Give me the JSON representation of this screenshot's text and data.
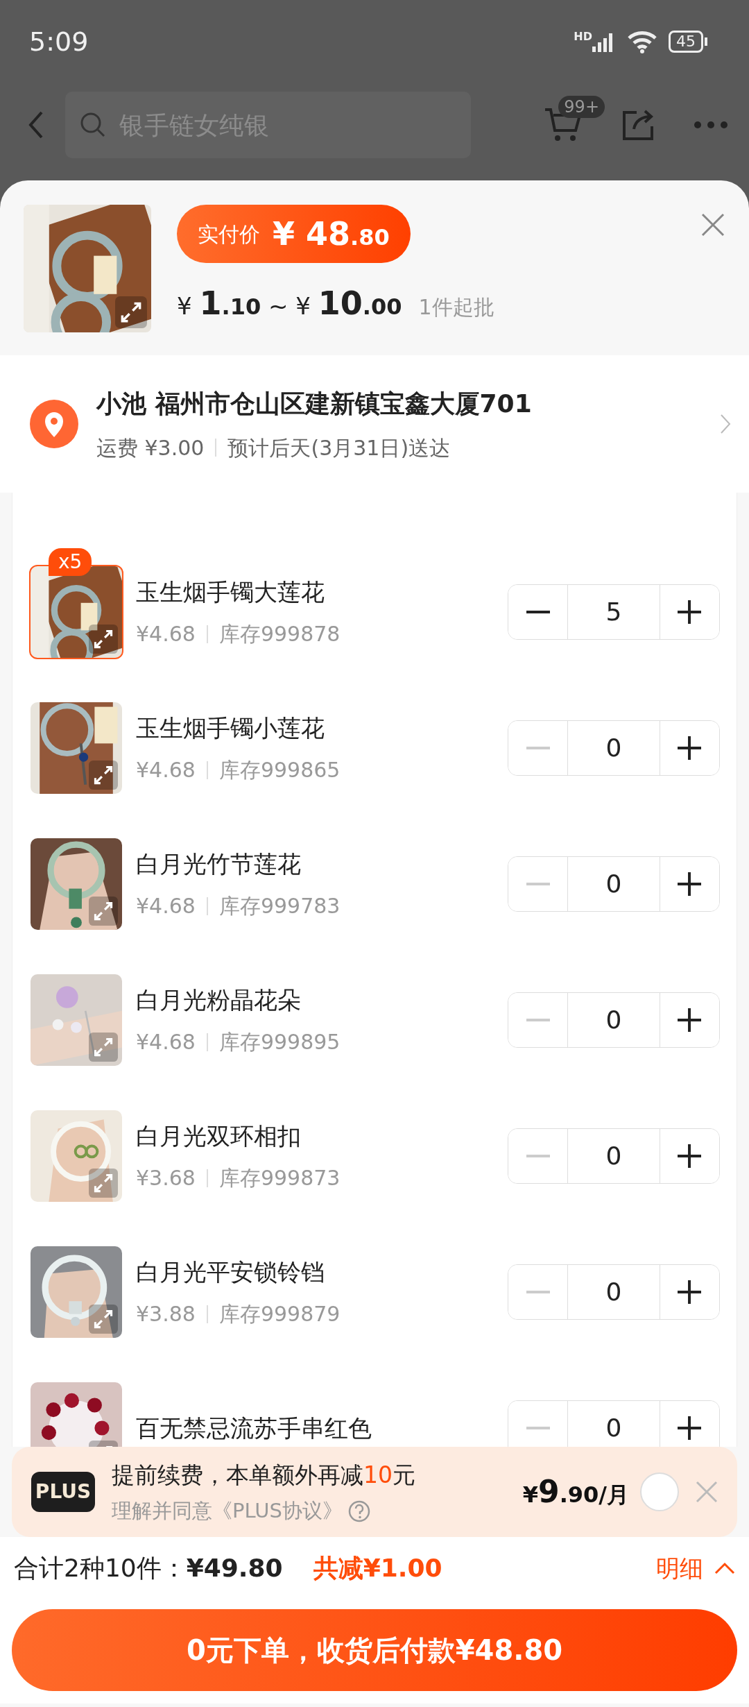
{
  "status_bar": {
    "time": "5:09",
    "network": "HD",
    "battery": "45"
  },
  "top_bar": {
    "search": {
      "placeholder": "银手链女纯银"
    },
    "cart_badge": "99+"
  },
  "sheet": {
    "pay_label": "实付价",
    "pay_price": {
      "currency": "¥",
      "whole": "48",
      "fraction": ".80"
    },
    "range": [
      {
        "currency": "¥",
        "whole": "1",
        "fraction": ".10"
      },
      {
        "currency": "¥",
        "whole": "10",
        "fraction": ".00"
      }
    ],
    "range_sep": "~",
    "min_order": "1件起批"
  },
  "address": {
    "line": "小池 福州市仓山区建新镇宝鑫大厦701",
    "shipping_label": "运费",
    "shipping": "¥3.00",
    "delivery": "预计后天(3月31日)送达"
  },
  "items": [
    {
      "name": "玉生烟手镯大莲花",
      "price": "¥4.68",
      "stock": "库存999878",
      "quantity": "5",
      "badge": "x5",
      "selected": true,
      "decrease_disabled": false
    },
    {
      "name": "玉生烟手镯小莲花",
      "price": "¥4.68",
      "stock": "库存999865",
      "quantity": "0",
      "selected": false,
      "decrease_disabled": true
    },
    {
      "name": "白月光竹节莲花",
      "price": "¥4.68",
      "stock": "库存999783",
      "quantity": "0",
      "selected": false,
      "decrease_disabled": true
    },
    {
      "name": "白月光粉晶花朵",
      "price": "¥4.68",
      "stock": "库存999895",
      "quantity": "0",
      "selected": false,
      "decrease_disabled": true
    },
    {
      "name": "白月光双环相扣",
      "price": "¥3.68",
      "stock": "库存999873",
      "quantity": "0",
      "selected": false,
      "decrease_disabled": true
    },
    {
      "name": "白月光平安锁铃铛",
      "price": "¥3.88",
      "stock": "库存999879",
      "quantity": "0",
      "selected": false,
      "decrease_disabled": true
    },
    {
      "name": "百无禁忌流苏手串红色",
      "quantity": "0",
      "selected": false,
      "decrease_disabled": true
    }
  ],
  "plus_offer": {
    "logo": "PLUS",
    "title_before": "提前续费，本单额外再减",
    "title_highlight": "10",
    "title_after": "元",
    "agreement": "理解并同意《PLUS协议》",
    "price": {
      "currency": "¥",
      "whole": "9",
      "fraction": ".90/月"
    },
    "checked": false
  },
  "summary": {
    "count": "合计2种10件：",
    "total": "¥49.80",
    "discount_label": "共减",
    "discount": "¥1.00",
    "details": "明细",
    "details_expanded": false
  },
  "submit_button": "0元下单，收货后付款¥48.80"
}
